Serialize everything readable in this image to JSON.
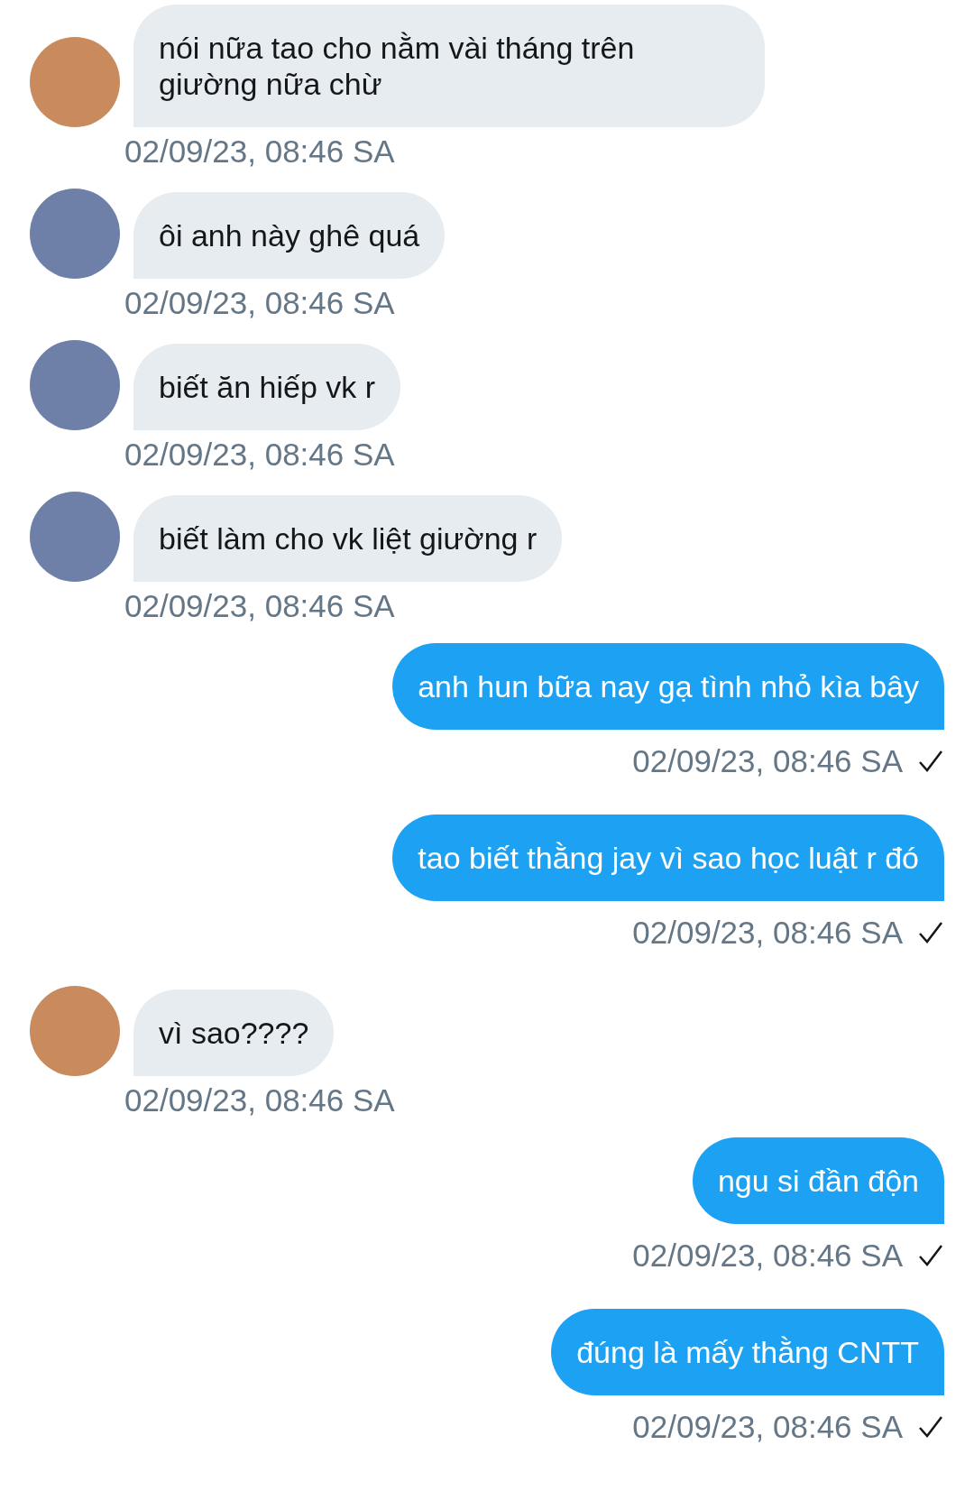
{
  "messages": [
    {
      "kind": "incoming",
      "color": "#c98a5e",
      "text": "nói nữa tao cho nằm vài tháng trên giường nữa chừ",
      "time": "02/09/23, 08:46 SA"
    },
    {
      "kind": "incoming",
      "color": "#6e7fa8",
      "text": "ôi anh này ghê quá",
      "time": "02/09/23, 08:46 SA"
    },
    {
      "kind": "incoming",
      "color": "#6e7fa8",
      "text": "biết ăn hiếp vk r",
      "time": "02/09/23, 08:46 SA"
    },
    {
      "kind": "incoming",
      "color": "#6e7fa8",
      "text": "biết làm cho vk liệt giường r",
      "time": "02/09/23, 08:46 SA"
    },
    {
      "kind": "outgoing",
      "sent": true,
      "text": "anh hun bữa nay gạ tình nhỏ kìa bây",
      "time": "02/09/23, 08:46 SA"
    },
    {
      "kind": "outgoing",
      "sent": true,
      "text": "tao biết thằng jay vì sao học luật r đó",
      "time": "02/09/23, 08:46 SA"
    },
    {
      "kind": "incoming",
      "color": "#c98a5e",
      "text": "vì sao????",
      "time": "02/09/23, 08:46 SA"
    },
    {
      "kind": "outgoing",
      "sent": true,
      "text": "ngu si đần độn",
      "time": "02/09/23, 08:46 SA"
    },
    {
      "kind": "outgoing",
      "sent": true,
      "text": "đúng là mấy thằng CNTT",
      "time": "02/09/23, 08:46 SA"
    }
  ]
}
